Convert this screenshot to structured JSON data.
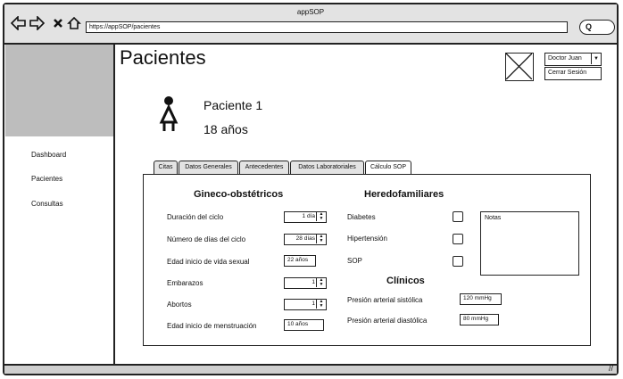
{
  "window": {
    "title": "appSOP"
  },
  "browser": {
    "url": "https://appSOP/pacientes",
    "back_icon": "arrow-left-icon",
    "forward_icon": "arrow-right-icon",
    "close_icon": "close-icon",
    "home_icon": "home-icon",
    "search_glyph": "Q"
  },
  "sidebar": {
    "items": [
      {
        "label": "Dashboard"
      },
      {
        "label": "Pacientes"
      },
      {
        "label": "Consultas"
      }
    ]
  },
  "page": {
    "title": "Pacientes"
  },
  "header": {
    "user": "Doctor Juan",
    "logout": "Cerrar Sesión"
  },
  "patient": {
    "name": "Paciente 1",
    "age": "18 años"
  },
  "tabs": [
    {
      "label": "Citas"
    },
    {
      "label": "Datos Generales"
    },
    {
      "label": "Antecedentes"
    },
    {
      "label": "Datos Laboratoriales"
    },
    {
      "label": "Cálculo SOP"
    }
  ],
  "gineco": {
    "title": "Gineco-obstétricos",
    "fields": [
      {
        "label": "Duración del ciclo",
        "value": "1 día"
      },
      {
        "label": "Número de días del ciclo",
        "value": "28 días"
      },
      {
        "label": "Edad inicio de vida sexual",
        "value": "22 años"
      },
      {
        "label": "Embarazos",
        "value": "1"
      },
      {
        "label": "Abortos",
        "value": "1"
      },
      {
        "label": "Edad inicio de menstruación",
        "value": "10 años"
      }
    ]
  },
  "heredo": {
    "title": "Heredofamiliares",
    "items": [
      {
        "label": "Diabetes"
      },
      {
        "label": "Hipertensión"
      },
      {
        "label": "SOP"
      }
    ],
    "notes_placeholder": "Notas"
  },
  "clinicos": {
    "title": "Clínicos",
    "fields": [
      {
        "label": "Presión arterial sistólica",
        "value": "120 mmHg"
      },
      {
        "label": "Presión arterial diastólica",
        "value": "80 mmHg"
      }
    ]
  }
}
